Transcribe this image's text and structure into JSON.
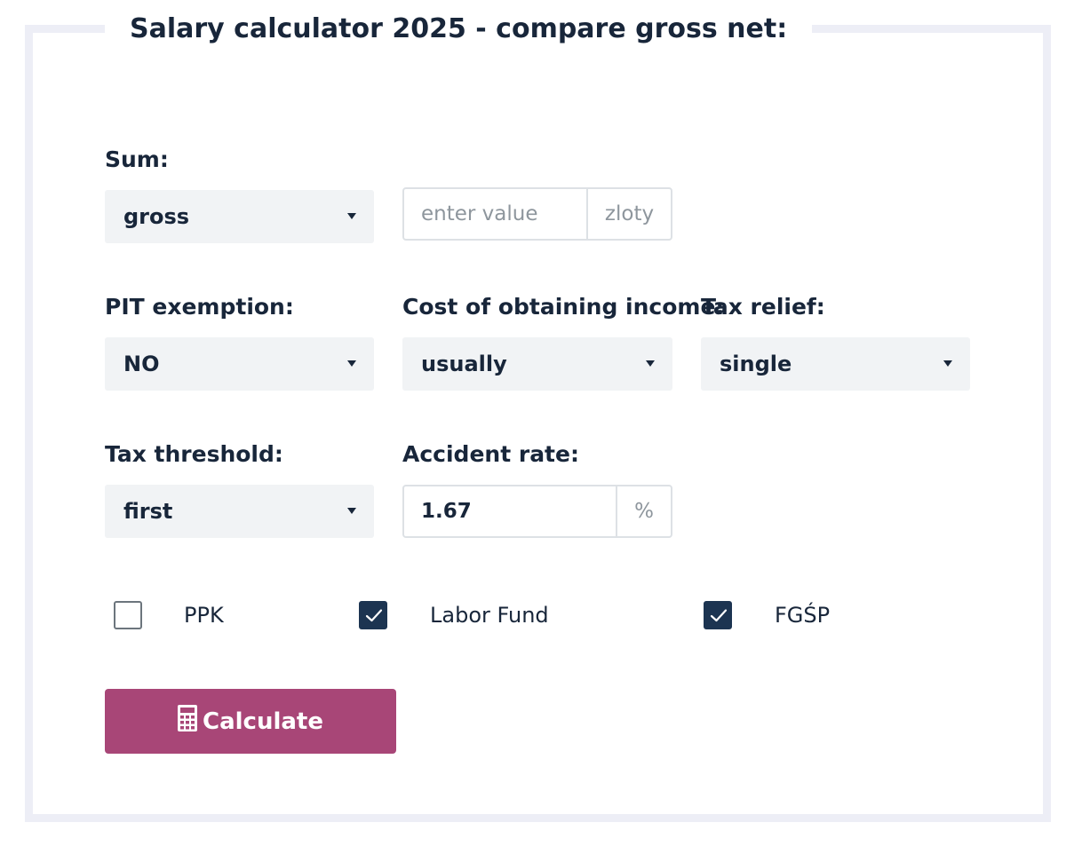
{
  "title": "Salary calculator 2025 - compare gross net:",
  "sum": {
    "label": "Sum:",
    "type_value": "gross",
    "amount_placeholder": "enter value",
    "currency": "zloty"
  },
  "pit_exemption": {
    "label": "PIT exemption:",
    "value": "NO"
  },
  "cost_of_income": {
    "label": "Cost of obtaining income:",
    "value": "usually"
  },
  "tax_relief": {
    "label": "Tax relief:",
    "value": "single"
  },
  "tax_threshold": {
    "label": "Tax threshold:",
    "value": "first"
  },
  "accident_rate": {
    "label": "Accident rate:",
    "value": "1.67",
    "unit": "%"
  },
  "checkboxes": [
    {
      "label": "PPK",
      "checked": false
    },
    {
      "label": "Labor Fund",
      "checked": true
    },
    {
      "label": "FGŚP",
      "checked": true
    }
  ],
  "calculate_button": {
    "label": "Calculate",
    "icon": "calculator-icon"
  },
  "colors": {
    "primary_dark": "#1c3451",
    "button": "#a84677",
    "frame": "#edeef6",
    "select_bg": "#f1f3f5"
  }
}
